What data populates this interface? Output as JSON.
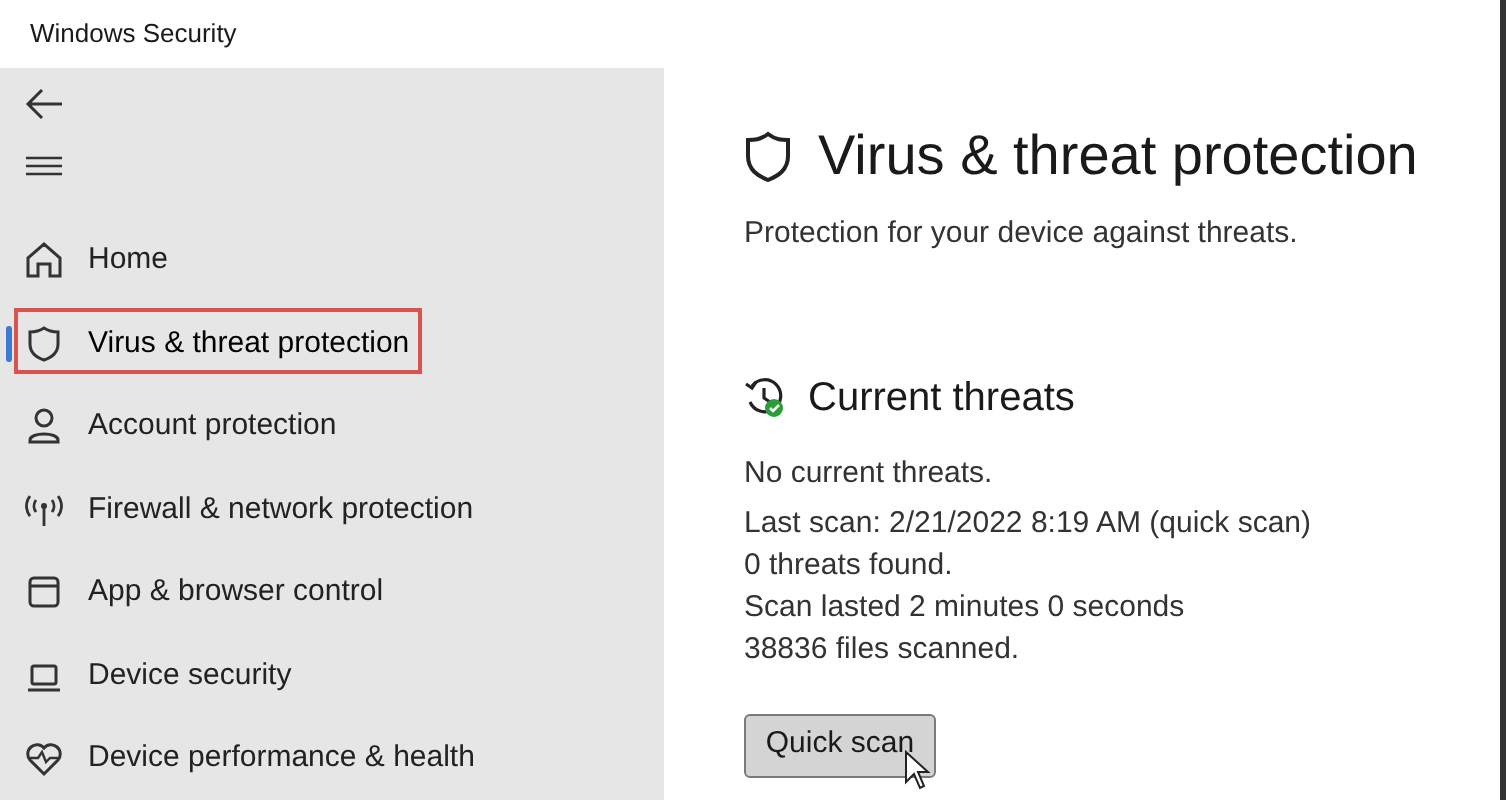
{
  "window": {
    "title": "Windows Security"
  },
  "sidebar": {
    "items": [
      {
        "label": "Home",
        "selected": false,
        "highlighted": false
      },
      {
        "label": "Virus & threat protection",
        "selected": true,
        "highlighted": true
      },
      {
        "label": "Account protection",
        "selected": false,
        "highlighted": false
      },
      {
        "label": "Firewall & network protection",
        "selected": false,
        "highlighted": false
      },
      {
        "label": "App & browser control",
        "selected": false,
        "highlighted": false
      },
      {
        "label": "Device security",
        "selected": false,
        "highlighted": false
      },
      {
        "label": "Device performance & health",
        "selected": false,
        "highlighted": false
      }
    ]
  },
  "page": {
    "title": "Virus & threat protection",
    "subtitle": "Protection for your device against threats.",
    "section": {
      "title": "Current threats",
      "lines": [
        "No current threats.",
        "Last scan: 2/21/2022 8:19 AM (quick scan)",
        "0 threats found.",
        "Scan lasted 2 minutes 0 seconds",
        "38836 files scanned."
      ],
      "button": "Quick scan"
    }
  }
}
